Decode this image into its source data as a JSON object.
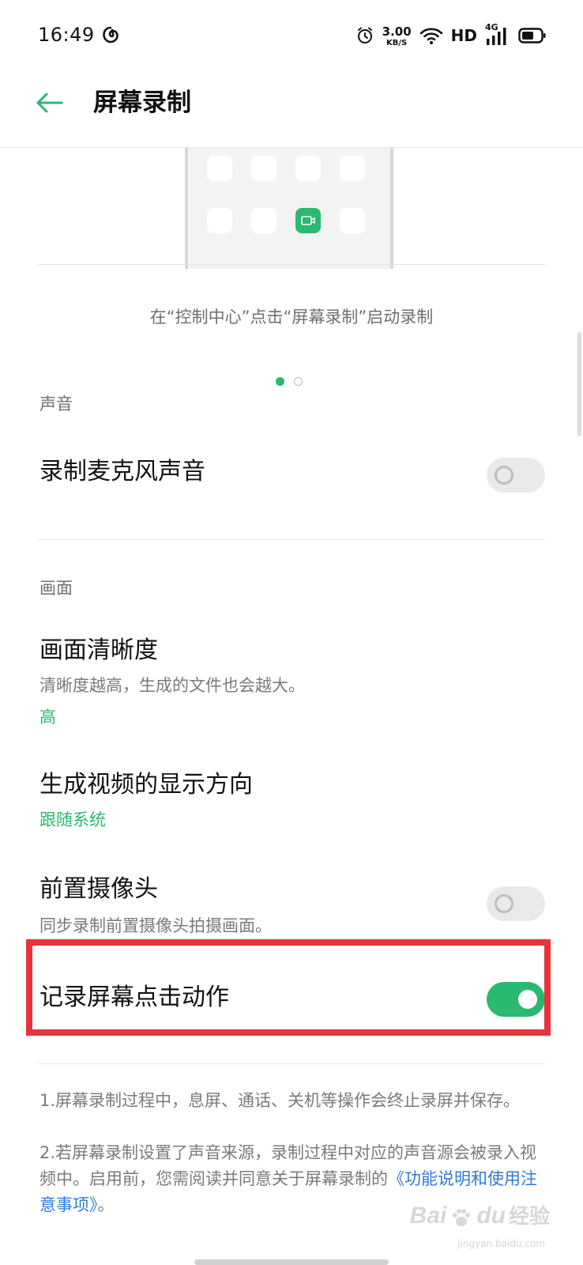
{
  "status_bar": {
    "time": "16:49",
    "net_speed_value": "3.00",
    "net_speed_unit": "KB/S",
    "hd_label": "HD",
    "network_type": "4G"
  },
  "header": {
    "title": "屏幕录制",
    "accent_color": "#2bb86f"
  },
  "illustration": {
    "caption": "在“控制中心”点击“屏幕录制”启动录制",
    "page_dots": {
      "total": 2,
      "active": 1
    }
  },
  "sections": {
    "sound": {
      "label": "声音",
      "mic": {
        "title": "录制麦克风声音",
        "enabled": false
      }
    },
    "picture": {
      "label": "画面",
      "clarity": {
        "title": "画面清晰度",
        "subtitle": "清晰度越高，生成的文件也会越大。",
        "value": "高"
      },
      "orientation": {
        "title": "生成视频的显示方向",
        "value": "跟随系统"
      },
      "front_camera": {
        "title": "前置摄像头",
        "subtitle": "同步录制前置摄像头拍摄画面。",
        "enabled": false
      },
      "tap_actions": {
        "title": "记录屏幕点击动作",
        "enabled": true
      }
    }
  },
  "footnotes": {
    "line1": "1.屏幕录制过程中，息屏、通话、关机等操作会终止录屏并保存。",
    "line2": "2.若屏幕录制设置了声音来源，录制过程中对应的声音源会被录入视频中。启用前，您需阅读并同意关于屏幕录制的",
    "link": "《功能说明和使用注意事项》",
    "line2_end": "。"
  },
  "watermark": {
    "brand": "Bai",
    "brand2": "du",
    "cn": "经验",
    "url": "jingyan.baidu.com"
  },
  "colors": {
    "accent": "#2bb86f",
    "highlight": "#e8323c",
    "link": "#2f7bd6"
  }
}
